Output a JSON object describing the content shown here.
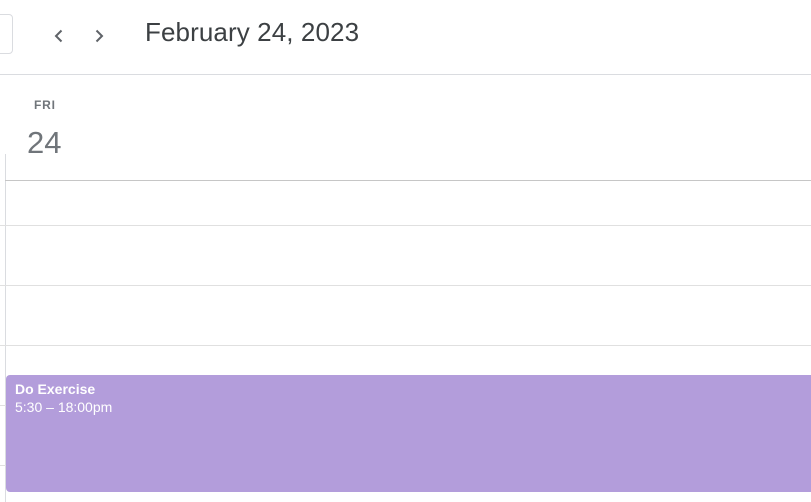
{
  "header": {
    "date_title": "February 24, 2023",
    "prev_icon": "chevron-left-icon",
    "next_icon": "chevron-right-icon"
  },
  "day": {
    "abbrev": "FRI",
    "number": "24"
  },
  "events": [
    {
      "title": "Do Exercise",
      "time": "5:30 – 18:00pm",
      "color": "#b39ddb"
    }
  ],
  "colors": {
    "border": "#dadce0",
    "text_primary": "#3c4043",
    "text_secondary": "#70757a"
  }
}
